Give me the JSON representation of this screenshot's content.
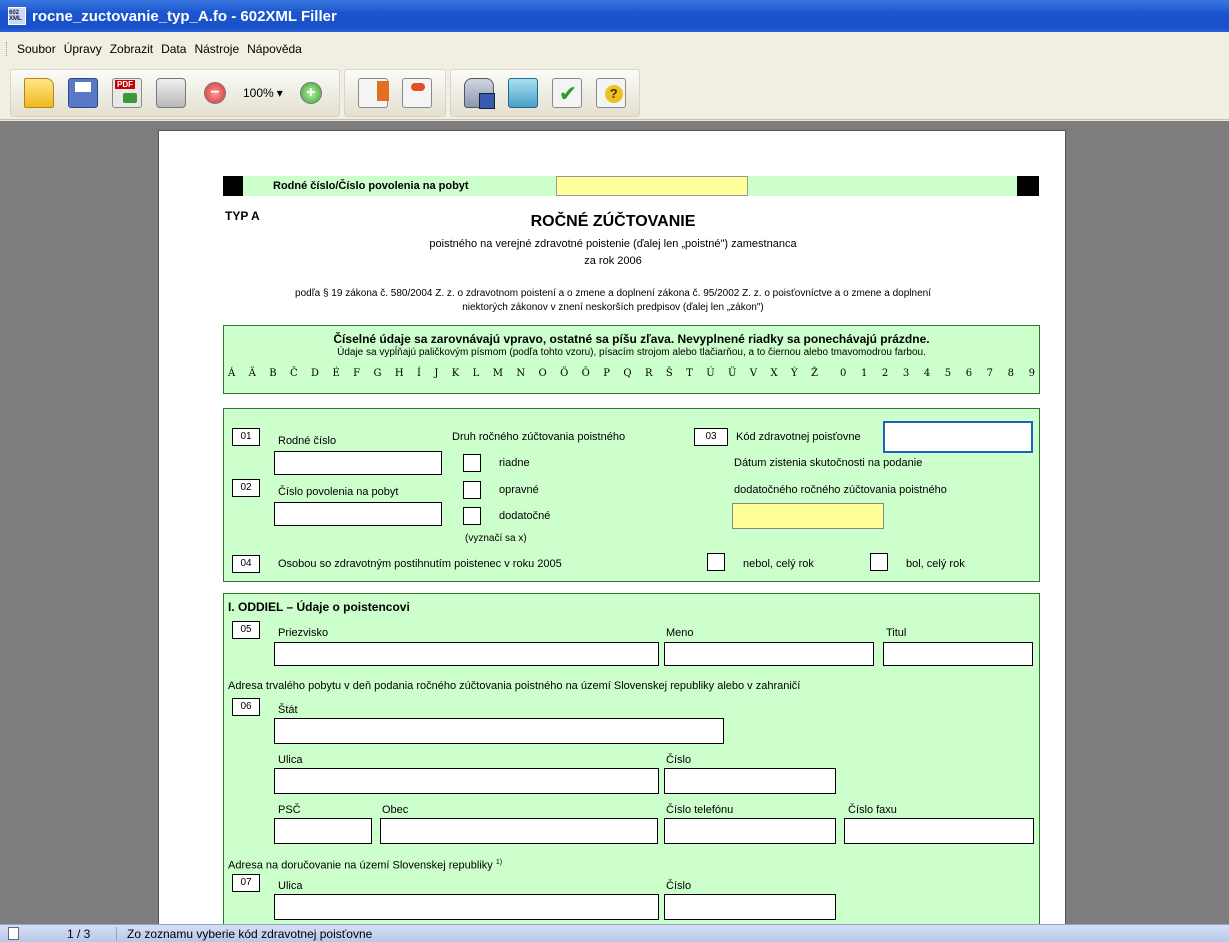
{
  "window": {
    "title": "rocne_zuctovanie_typ_A.fo - 602XML Filler",
    "icon_text": "602 XML"
  },
  "menu": [
    "Soubor",
    "Úpravy",
    "Zobrazit",
    "Data",
    "Nástroje",
    "Nápověda"
  ],
  "toolbar": {
    "zoom_value": "100%",
    "zoom_arrow": "▾",
    "zoom_out": "−",
    "zoom_in": "+"
  },
  "form": {
    "top_label": "Rodné číslo/Číslo povolenia na pobyt",
    "typ": "TYP A",
    "title": "ROČNÉ ZÚČTOVANIE",
    "subtitle": "poistného na verejné zdravotné poistenie (ďalej len „poistné\") zamestnanca",
    "year_line": "za rok 2006",
    "law_line1": "podľa § 19 zákona č. 580/2004 Z. z. o zdravotnom poistení a o zmene a doplnení zákona č. 95/2002 Z. z. o poisťovníctve a o zmene a doplnení",
    "law_line2": "niektorých zákonov v znení neskorších predpisov (ďalej len „zákon\")",
    "instructions_bold": "Číselné údaje sa zarovnávajú vpravo, ostatné sa píšu zľava. Nevyplnené riadky sa ponechávajú prázdne.",
    "instructions_small": "Údaje sa vypĺňajú paličkovým písmom (podľa tohto vzoru), písacím strojom alebo tlačiarňou, a to čiernou alebo tmavomodrou farbou.",
    "alphabet": [
      "Á",
      "Ä",
      "B",
      "Č",
      "D",
      "É",
      "F",
      "G",
      "H",
      "Í",
      "J",
      "K",
      "L",
      "M",
      "N",
      "O",
      "Ö",
      "Ô",
      "P",
      "Q",
      "R",
      "Š",
      "T",
      "Ú",
      "Ü",
      "V",
      "X",
      "Ý",
      "Ž"
    ],
    "digits": [
      "0",
      "1",
      "2",
      "3",
      "4",
      "5",
      "6",
      "7",
      "8",
      "9"
    ],
    "s1": {
      "n01": "01",
      "rodne_cislo": "Rodné číslo",
      "druh": "Druh ročného zúčtovania poistného",
      "riadne": "riadne",
      "opravne": "opravné",
      "dodatocne": "dodatočné",
      "vyznaci": "(vyznačí sa x)",
      "n02": "02",
      "cislo_povolenia": "Číslo povolenia na pobyt",
      "n03": "03",
      "kod": "Kód zdravotnej poisťovne",
      "datum1": "Dátum zistenia skutočnosti na podanie",
      "datum2": "dodatočného ročného zúčtovania poistného",
      "n04": "04",
      "osoba": "Osobou so zdravotným postihnutím poistenec v roku 2005",
      "nebol": "nebol, celý rok",
      "bol": "bol, celý rok"
    },
    "s2": {
      "header": "I. ODDIEL – Údaje o poistencovi",
      "n05": "05",
      "priezvisko": "Priezvisko",
      "meno": "Meno",
      "titul": "Titul",
      "adresa": "Adresa trvalého pobytu v deň podania ročného zúčtovania poistného na území Slovenskej republiky alebo v zahraničí",
      "n06": "06",
      "stat": "Štát",
      "ulica": "Ulica",
      "cislo": "Číslo",
      "psc": "PSČ",
      "obec": "Obec",
      "telefon": "Číslo telefónu",
      "fax": "Číslo faxu",
      "dorucovanie": "Adresa na doručovanie na území Slovenskej republiky",
      "footnote": "1)",
      "n07": "07",
      "ulica2": "Ulica",
      "cislo2": "Číslo"
    }
  },
  "status": {
    "pages": "1 / 3",
    "message": "Zo zoznamu vyberie kód zdravotnej poisťovne"
  }
}
